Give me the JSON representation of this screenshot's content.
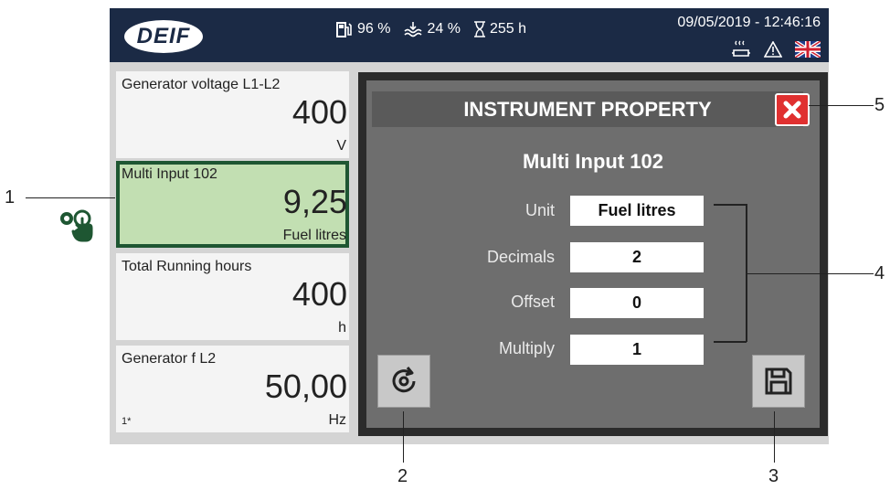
{
  "header": {
    "logo": "DEIF",
    "fuel_level": "96 %",
    "coolant_level": "24 %",
    "running_time": "255 h",
    "datetime": "09/05/2019 - 12:46:16",
    "right_icons": [
      "heater-icon",
      "warning-icon",
      "uk-flag-icon"
    ]
  },
  "tiles": [
    {
      "title": "Generator voltage L1-L2",
      "value": "400",
      "unit": "V"
    },
    {
      "title": "Multi Input 102",
      "value": "9,25",
      "unit": "Fuel litres"
    },
    {
      "title": "Total Running hours",
      "value": "400",
      "unit": "h"
    },
    {
      "title": "Generator f L2",
      "value": "50,00",
      "unit": "Hz",
      "note": "1*"
    }
  ],
  "dialog": {
    "header": "INSTRUMENT PROPERTY",
    "title": "Multi Input 102",
    "fields": [
      {
        "label": "Unit",
        "value": "Fuel litres"
      },
      {
        "label": "Decimals",
        "value": "2"
      },
      {
        "label": "Offset",
        "value": "0"
      },
      {
        "label": "Multiply",
        "value": "1"
      }
    ],
    "close_icon": "close-icon",
    "reset_icon": "reset-icon",
    "save_icon": "save-icon"
  },
  "callouts": {
    "c1": "1",
    "c2": "2",
    "c3": "3",
    "c4": "4",
    "c5": "5"
  },
  "colors": {
    "header_bg": "#1b2a45",
    "selected_tile": "#c2dfb2",
    "selected_border": "#1e5632",
    "close_red": "#e03030"
  }
}
